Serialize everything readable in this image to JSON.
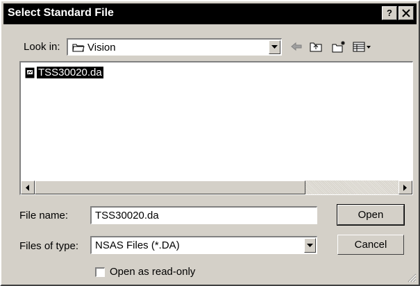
{
  "window": {
    "title": "Select Standard File",
    "help_button": "?",
    "close_button": "X"
  },
  "look_in": {
    "label": "Look in:",
    "value": "Vision"
  },
  "toolbar": {
    "back_icon": "back-arrow-icon",
    "up_icon": "up-folder-icon",
    "new_folder_icon": "new-folder-icon",
    "view_menu_icon": "view-menu-icon"
  },
  "file_list": {
    "items": [
      {
        "name": "TSS30020.da",
        "selected": true,
        "icon": "file-icon"
      }
    ]
  },
  "file_name": {
    "label": "File name:",
    "value": "TSS30020.da"
  },
  "files_of_type": {
    "label": "Files of type:",
    "value": "NSAS Files (*.DA)"
  },
  "buttons": {
    "open": "Open",
    "cancel": "Cancel"
  },
  "read_only": {
    "label": "Open as read-only",
    "checked": false
  },
  "colors": {
    "face": "#d4d0c8",
    "titlebar": "#000000",
    "selection": "#000000"
  }
}
